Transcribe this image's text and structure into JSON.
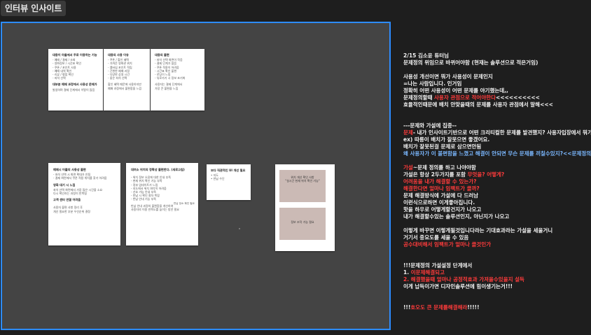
{
  "tab": {
    "title": "인터뷰 인사이트"
  },
  "cards": {
    "c1": {
      "title": "대용이 아들에서 주로 이용하는 기능",
      "lines": [
        "- 예매 / 결제 / 조회",
        "- 영화정보 / 시간표 확인",
        "- 쿠폰 / 포인트 사용",
        "- 예매 내역 확인",
        "- 리뷰 / 평점 확인",
        "- 좌석 선택"
      ],
      "foot": [
        "대부분 예매 과정에서 사용성 문제가",
        "발생하며 결제 단계에서 이탈이 많음"
      ]
    },
    "c2": {
      "title": "대용의 사용 이유",
      "lines": [
        "- 쿠폰 / 할인 혜택",
        "- 가까운 영화관 위치",
        "- 멤버십 포인트 적립",
        "- 간편한 예매 과정",
        "- 다양한 상영 시간",
        "- 좋은 좌석 선택"
      ],
      "foot": [
        "할인 혜택 때문에 사용하지만",
        "예매 과정에서 불편함을 느낌"
      ]
    },
    "c3": {
      "title": "대용의 불편",
      "lines": [
        "- 좌석 선택 화면이 작음",
        "- 결제 단계가 많음",
        "- 쿠폰 적용이 어려움",
        "- 시간표 확인 불편",
        "- 로딩이 느림",
        "- 뒤로가기 시 정보 초기화"
      ],
      "foot": [
        "사용자는 결제 단계에서",
        "가장 큰 불편을 느낌"
      ]
    },
    "c4": {
      "title": "예매시 어플의 사용성 불편",
      "lines": [
        "- 좌석 선택 시 화면 확대가 안됨",
        "- 결제 화면에서 쿠폰 적용 위치를 찾기 어려움"
      ],
      "mid": [
        "영화 대기 시 느낌",
        "좌석 선택 화면에서 가장 많은 시간을 소요",
        "다시 확인하는 과정이 반복됨"
      ],
      "mid2": "고객 센터 연결 어려움",
      "foot": [
        "사용자 불편 사항 정리 후",
        "개선 필요한 부분 우선순위 결정"
      ]
    },
    "c5": {
      "title": "대여소 위치의 정확성 불편한다. (새로고침)",
      "lines": [
        "- 위치 정보 오류에 대한 안내 부족",
        "- 현재 위치 확인 기능 부족",
        "- 정보 업데이트가 느림",
        "- 지도에서 위치 파악이 어려움",
        "- 선호 가능 안내 부족",
        "- 반납 시 확인 절차 복잡",
        "- 반납 안내 기능 부족"
      ],
      "side": "반납 장소 확인 필요",
      "foot": [
        "반납 안내 과정의 불편함을 개선하여",
        "사용자의 이용 만족도를 높이는 방안 필요"
      ]
    },
    "c6": {
      "title": "보다 직관적인 UI 개선 필요",
      "lines": [
        "• 지도",
        "• 반납 수단"
      ]
    }
  },
  "boxes": {
    "b1": {
      "lines": [
        "위치 개선 확인 사항",
        "\"실시간 현재 위치 확인 기능\""
      ]
    },
    "b2": {
      "lines": [
        "정보 조작 가능 필요"
      ]
    }
  },
  "notes": [
    {
      "text": "2/15 김소윤 튜터님",
      "color": "white"
    },
    {
      "text": "문제정의 위임으로 바뀌어야함 (현재는 솔루션으로 적은거임)",
      "color": "white"
    },
    {
      "text": "",
      "color": "white"
    },
    {
      "text": "사용성 개선이면 뭐가 사용성이 문제인지",
      "color": "white"
    },
    {
      "text": "=나는 사람입니다. 인거임",
      "color": "white"
    },
    {
      "text": "정확히 어떤 사용성이 어떤 문제를 야기했는데,,",
      "color": "white"
    },
    {
      "parts": [
        {
          "text": "문제정의할때 ",
          "color": "white"
        },
        {
          "text": "사용자 관점으로 적어야한다",
          "color": "red"
        },
        {
          "text": "<<<<<<<<<<",
          "color": "white"
        }
      ]
    },
    {
      "text": "효율적인때문에 배치 안맞을때의 문제를 사용자 관점에서 말해<<<",
      "color": "white"
    },
    {
      "text": "",
      "color": "white"
    },
    {
      "text": "",
      "color": "white"
    },
    {
      "text": "---문제와 가설에 집중--",
      "color": "white"
    },
    {
      "parts": [
        {
          "text": "문제",
          "color": "red"
        },
        {
          "text": "- 내가 인사이트기반으로 어떤 크리티컬한 문제를 발견했지? 사용자입장에서 뭐가 문제지?",
          "color": "white"
        }
      ]
    },
    {
      "text": "ex) 따릉이 배치가 잘못으면 좋겠어요.",
      "color": "white"
    },
    {
      "text": "배치가 잘못된걸 문제로 삼으면안됨",
      "color": "white"
    },
    {
      "text": "왜 사용자가 이 불편함을 느꼈고 해결이 안되면 무슨 문제를 끼칠수있지?<<문제정의단계에서",
      "color": "blue"
    },
    {
      "text": "",
      "color": "white"
    },
    {
      "parts": [
        {
          "text": "가설",
          "color": "red"
        },
        {
          "text": "~문제 정의를 하고 나야야함",
          "color": "white"
        }
      ]
    },
    {
      "parts": [
        {
          "text": "가설은 항상 2두가지를 포함 ",
          "color": "white"
        },
        {
          "text": "무엇을? 어떻게?",
          "color": "red"
        }
      ]
    },
    {
      "text": "어려움을 내가 해결할 수 있는가?",
      "color": "red"
    },
    {
      "text": "해결한다면 얼마나 임팩트가 클까?",
      "color": "red"
    },
    {
      "text": "문제 해결방식에 가설에 다 드러남",
      "color": "white"
    },
    {
      "text": "이런식으로하면 이게좋아집니다.",
      "color": "white"
    },
    {
      "text": "핫을 하우로 어떻게할건지가 나오고",
      "color": "white"
    },
    {
      "text": "내가 해결할수있는 솔루션인지, 아닌지가 나오고",
      "color": "white"
    },
    {
      "text": "",
      "color": "white"
    },
    {
      "text": "이렇게 바꾸면 이렇게될것입니다라는 기대효과라는 가설을 세울거니",
      "color": "white"
    },
    {
      "text": "거기서 중요도를 세울 수 있음",
      "color": "white"
    },
    {
      "text": "공수대비해서 임팩트가 얼마나 클것인가",
      "color": "red"
    },
    {
      "text": "",
      "color": "white"
    },
    {
      "text": "",
      "color": "white"
    },
    {
      "text": "!!!문제정의 가설설정 단계에서",
      "color": "white"
    },
    {
      "parts": [
        {
          "text": "1. ",
          "color": "white"
        },
        {
          "text": "이문제해결되고",
          "color": "red"
        }
      ]
    },
    {
      "text": "2. 해결했을때 얼마나 공정적효과 가져올수있을지 설득",
      "color": "red"
    },
    {
      "text": "이게 납득이가면 디자인솔루션에 힘이생기는거!!!",
      "color": "white"
    },
    {
      "text": "",
      "color": "white"
    },
    {
      "text": "",
      "color": "white"
    },
    {
      "parts": [
        {
          "text": "!!!",
          "color": "white"
        },
        {
          "text": "호오도 큰 문제를해결해라",
          "color": "red"
        },
        {
          "text": "!!!!!",
          "color": "white"
        }
      ]
    }
  ],
  "colors": {
    "white": "#f2f2f2",
    "red": "#ff3b3b",
    "blue": "#7bb8ff",
    "accent": "#2d8cff"
  }
}
